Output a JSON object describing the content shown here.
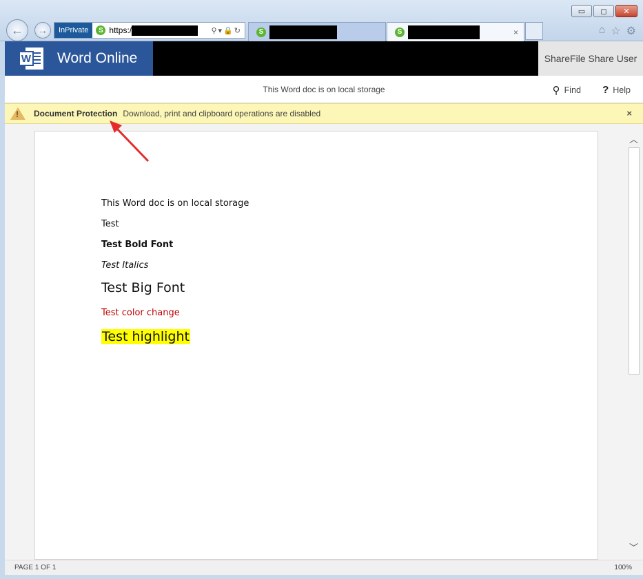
{
  "browser": {
    "mode_badge": "InPrivate",
    "address_prefix": "https:/",
    "tab_close": "×",
    "window_buttons": {
      "minimize": "▭",
      "maximize": "◻",
      "close": "✕"
    },
    "nav_back_glyph": "←",
    "nav_forward_glyph": "→",
    "tool_icons": [
      "home-icon",
      "favorites-star-icon",
      "settings-gear-icon"
    ]
  },
  "app": {
    "brand_name": "Word Online",
    "user_name": "ShareFile Share User",
    "brand_color": "#2b579a"
  },
  "subheader": {
    "doc_title": "This Word doc is on local storage",
    "find_label": "Find",
    "help_label": "Help"
  },
  "protection": {
    "title": "Document Protection",
    "message": "Download, print and clipboard operations are disabled",
    "close_glyph": "×"
  },
  "document": {
    "paragraphs": [
      "This Word doc is on local storage",
      "Test",
      "Test Bold Font",
      "Test Italics",
      "Test Big Font",
      "Test color change",
      "Test highlight"
    ],
    "color_change_color": "#c00000",
    "highlight_color": "#ffff00"
  },
  "status": {
    "page_info": "PAGE 1 OF 1",
    "zoom": "100%"
  },
  "annotation": {
    "arrow_color": "#e32b2b"
  }
}
